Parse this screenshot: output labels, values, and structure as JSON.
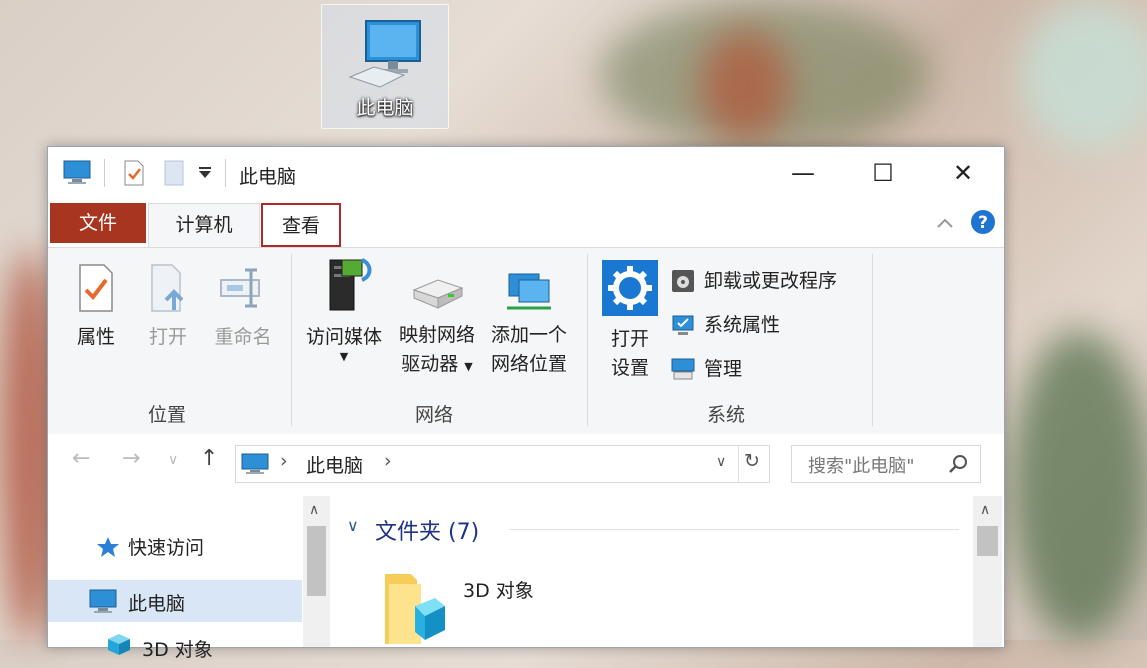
{
  "desktop_icon": {
    "label": "此电脑",
    "icon": "computer-icon"
  },
  "window": {
    "title": "此电脑",
    "quick_access_icons": [
      "computer-icon",
      "properties-icon",
      "new-folder-icon",
      "customize-dropdown-icon"
    ],
    "controls": {
      "minimize": "—",
      "maximize": "☐",
      "close": "✕"
    }
  },
  "tabs": [
    {
      "label": "文件",
      "color": "#a8351f"
    },
    {
      "label": "计算机"
    },
    {
      "label": "查看",
      "highlight_color": "#b0282a"
    }
  ],
  "ribbon": {
    "groups": [
      {
        "label": "位置",
        "buttons": [
          {
            "label": "属性",
            "icon": "properties-icon"
          },
          {
            "label": "打开",
            "icon": "open-icon",
            "disabled": true
          },
          {
            "label": "重命名",
            "icon": "rename-icon",
            "disabled": true
          }
        ]
      },
      {
        "label": "网络",
        "buttons": [
          {
            "label": "访问媒体",
            "icon": "media-icon"
          },
          {
            "label1": "映射网络",
            "label2": "驱动器",
            "icon": "network-drive-icon"
          },
          {
            "label1": "添加一个",
            "label2": "网络位置",
            "icon": "network-location-icon"
          }
        ]
      },
      {
        "label": "系统",
        "buttons": [
          {
            "label1": "打开",
            "label2": "设置",
            "icon": "settings-gear-icon"
          }
        ],
        "small_buttons": [
          {
            "label": "卸载或更改程序",
            "icon": "uninstall-icon"
          },
          {
            "label": "系统属性",
            "icon": "system-properties-icon"
          },
          {
            "label": "管理",
            "icon": "manage-icon"
          }
        ]
      }
    ]
  },
  "address_bar": {
    "path": "此电脑",
    "separator": "›"
  },
  "search": {
    "placeholder": "搜索\"此电脑\""
  },
  "navigation_pane": {
    "items": [
      {
        "label": "快速访问",
        "icon": "star-icon"
      },
      {
        "label": "此电脑",
        "icon": "computer-icon",
        "selected": true
      },
      {
        "label": "3D 对象",
        "icon": "3d-objects-icon"
      }
    ]
  },
  "content": {
    "group_header": "文件夹 (7)",
    "items": [
      {
        "label": "3D 对象",
        "icon": "3d-folder-icon"
      }
    ]
  }
}
